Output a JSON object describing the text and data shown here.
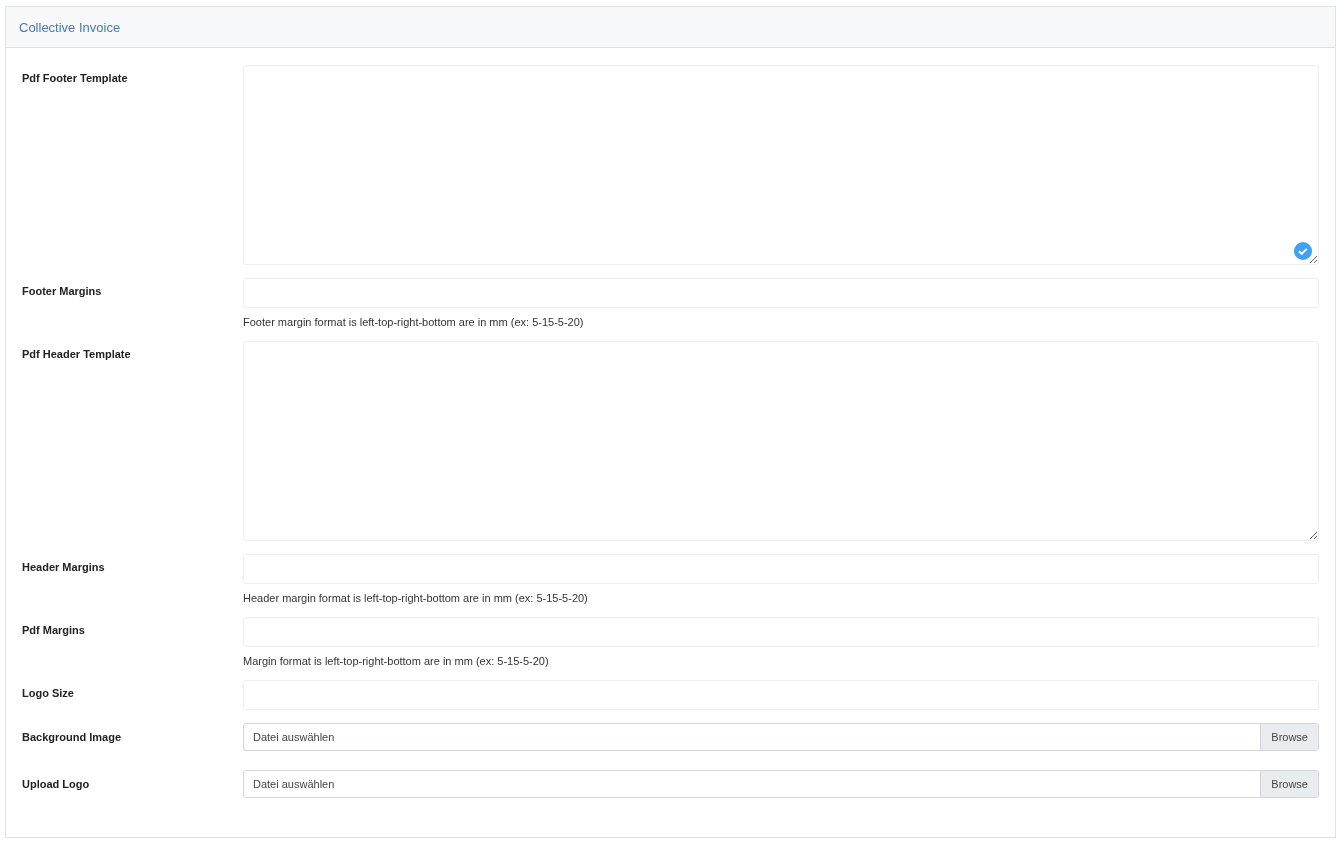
{
  "panel": {
    "title": "Collective Invoice"
  },
  "fields": [
    {
      "kind": "textarea",
      "label": "Pdf Footer Template",
      "check_badge": true
    },
    {
      "kind": "text",
      "label": "Footer Margins",
      "help": "Footer margin format is left-top-right-bottom are in mm (ex: 5-15-5-20)"
    },
    {
      "kind": "textarea",
      "label": "Pdf Header Template",
      "check_badge": false
    },
    {
      "kind": "text",
      "label": "Header Margins",
      "help": "Header margin format is left-top-right-bottom are in mm (ex: 5-15-5-20)"
    },
    {
      "kind": "text",
      "label": "Pdf Margins",
      "help": "Margin format is left-top-right-bottom are in mm (ex: 5-15-5-20)"
    },
    {
      "kind": "text",
      "label": "Logo Size"
    },
    {
      "kind": "file",
      "label": "Background Image",
      "placeholder": "Datei auswählen",
      "button": "Browse"
    },
    {
      "kind": "file",
      "label": "Upload Logo",
      "placeholder": "Datei auswählen",
      "button": "Browse"
    }
  ]
}
